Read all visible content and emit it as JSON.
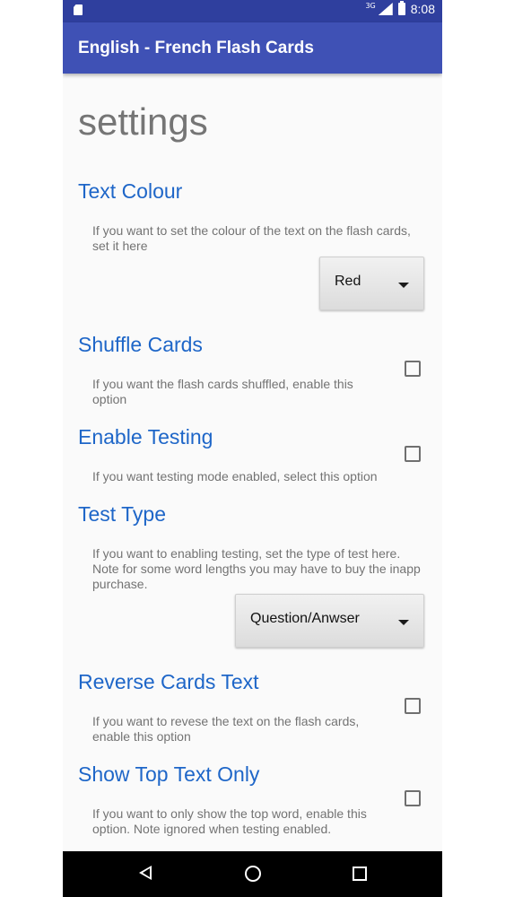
{
  "status_bar": {
    "network": "3G",
    "time": "8:08"
  },
  "app_bar": {
    "title": "English - French Flash Cards"
  },
  "page": {
    "title": "settings"
  },
  "settings": [
    {
      "title": "Text Colour",
      "desc": "If you want to set the colour of the text on the flash cards, set it here",
      "control": "dropdown",
      "value": "Red"
    },
    {
      "title": "Shuffle Cards",
      "desc": "If you want the flash cards shuffled, enable this option",
      "control": "checkbox",
      "checked": false
    },
    {
      "title": "Enable Testing",
      "desc": "If you want testing mode enabled, select this option",
      "control": "checkbox",
      "checked": false
    },
    {
      "title": "Test Type",
      "desc": "If you want to enabling testing, set the type of test here. Note for some word lengths you may have to buy the inapp purchase.",
      "control": "dropdown",
      "value": "Question/Anwser"
    },
    {
      "title": "Reverse Cards Text",
      "desc": "If you want to revese the text on the flash cards, enable this option",
      "control": "checkbox",
      "checked": false
    },
    {
      "title": "Show Top Text Only",
      "desc": "If you want to only show the top word, enable this option. Note ignored when testing enabled.",
      "control": "checkbox",
      "checked": false
    }
  ],
  "colors": {
    "status_bar": "#2f3f9e",
    "app_bar": "#3f51b5",
    "section_title": "#1e66c8",
    "page_title": "#757575",
    "description": "#737373"
  },
  "icons": [
    "sd-card-icon",
    "signal-icon",
    "battery-icon",
    "back-icon",
    "home-icon",
    "recents-icon",
    "dropdown-arrow-icon"
  ]
}
